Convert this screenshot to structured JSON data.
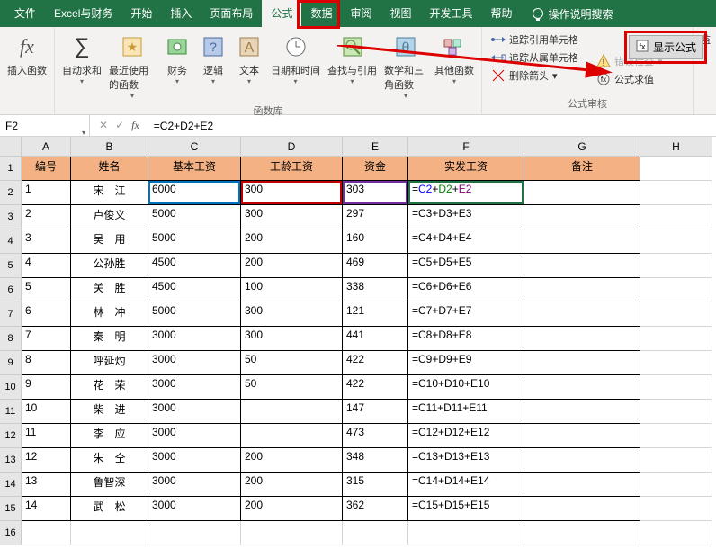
{
  "menu": {
    "tabs": [
      "文件",
      "Excel与财务",
      "开始",
      "插入",
      "页面布局",
      "公式",
      "数据",
      "审阅",
      "视图",
      "开发工具",
      "帮助"
    ],
    "active_index": 5,
    "search": "操作说明搜索"
  },
  "ribbon": {
    "insert_fn": "插入函数",
    "autosum": "自动求和",
    "recent": "最近使用的函数",
    "financial": "财务",
    "logical": "逻辑",
    "text": "文本",
    "datetime": "日期和时间",
    "lookup": "查找与引用",
    "math": "数学和三角函数",
    "more": "其他函数",
    "lib_label": "函数库",
    "trace_prec": "追踪引用单元格",
    "trace_dep": "追踪从属单元格",
    "remove_arrows": "删除箭头",
    "show_formulas": "显示公式",
    "error_check": "错误检查",
    "eval": "公式求值",
    "audit_label": "公式审核",
    "watch": "监"
  },
  "namebox": "F2",
  "formula_bar": "=C2+D2+E2",
  "cols": [
    "A",
    "B",
    "C",
    "D",
    "E",
    "F",
    "G",
    "H"
  ],
  "header_row": [
    "编号",
    "姓名",
    "基本工资",
    "工龄工资",
    "资金",
    "实发工资",
    "备注"
  ],
  "rows": [
    {
      "n": "1",
      "name": "宋　江",
      "base": "6000",
      "age": "300",
      "bonus": "303",
      "pay_parts": [
        "C2",
        "D2",
        "E2"
      ]
    },
    {
      "n": "2",
      "name": "卢俊义",
      "base": "5000",
      "age": "300",
      "bonus": "297",
      "pay": "=C3+D3+E3"
    },
    {
      "n": "3",
      "name": "吴　用",
      "base": "5000",
      "age": "200",
      "bonus": "160",
      "pay": "=C4+D4+E4"
    },
    {
      "n": "4",
      "name": "公孙胜",
      "base": "4500",
      "age": "200",
      "bonus": "469",
      "pay": "=C5+D5+E5"
    },
    {
      "n": "5",
      "name": "关　胜",
      "base": "4500",
      "age": "100",
      "bonus": "338",
      "pay": "=C6+D6+E6"
    },
    {
      "n": "6",
      "name": "林　冲",
      "base": "5000",
      "age": "300",
      "bonus": "121",
      "pay": "=C7+D7+E7"
    },
    {
      "n": "7",
      "name": "秦　明",
      "base": "3000",
      "age": "300",
      "bonus": "441",
      "pay": "=C8+D8+E8"
    },
    {
      "n": "8",
      "name": "呼延灼",
      "base": "3000",
      "age": "50",
      "bonus": "422",
      "pay": "=C9+D9+E9"
    },
    {
      "n": "9",
      "name": "花　荣",
      "base": "3000",
      "age": "50",
      "bonus": "422",
      "pay": "=C10+D10+E10"
    },
    {
      "n": "10",
      "name": "柴　进",
      "base": "3000",
      "age": "",
      "bonus": "147",
      "pay": "=C11+D11+E11"
    },
    {
      "n": "11",
      "name": "李　应",
      "base": "3000",
      "age": "",
      "bonus": "473",
      "pay": "=C12+D12+E12"
    },
    {
      "n": "12",
      "name": "朱　仝",
      "base": "3000",
      "age": "200",
      "bonus": "348",
      "pay": "=C13+D13+E13"
    },
    {
      "n": "13",
      "name": "鲁智深",
      "base": "3000",
      "age": "200",
      "bonus": "315",
      "pay": "=C14+D14+E14"
    },
    {
      "n": "14",
      "name": "武　松",
      "base": "3000",
      "age": "200",
      "bonus": "362",
      "pay": "=C15+D15+E15"
    }
  ],
  "row_heights": {
    "header": 27,
    "data": 27
  }
}
